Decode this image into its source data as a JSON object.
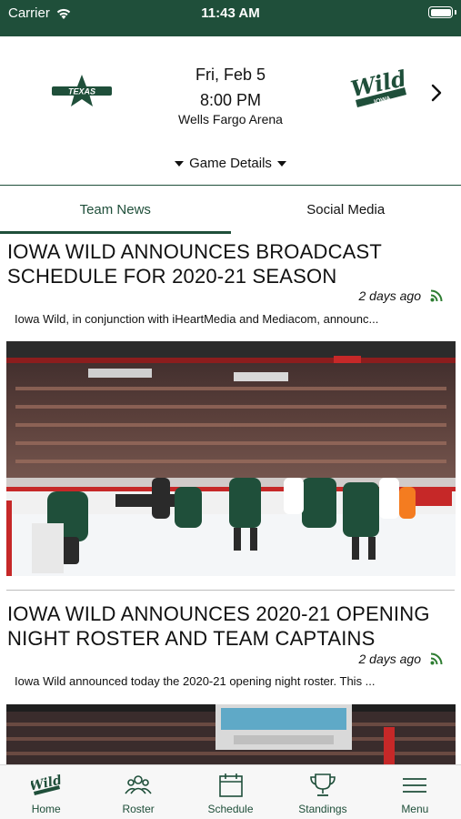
{
  "status_bar": {
    "carrier": "Carrier",
    "time": "11:43 AM",
    "icons": [
      "wifi-icon",
      "battery-icon"
    ]
  },
  "game": {
    "away_team_logo": "texas-stars-logo",
    "home_team_logo": "iowa-wild-logo",
    "home_logo_text": "Wild",
    "home_logo_subtext": "IOWA",
    "away_logo_text": "TEXAS",
    "date": "Fri, Feb 5",
    "time": "8:00 PM",
    "venue": "Wells Fargo Arena",
    "details_label": "Game Details"
  },
  "tabs": [
    {
      "label": "Team News",
      "active": true
    },
    {
      "label": "Social Media",
      "active": false
    }
  ],
  "articles": [
    {
      "headline_line1": "IOWA WILD ANNOUNCES BROADCAST",
      "headline_line2": "SCHEDULE FOR 2020-21 SEASON",
      "age": "2 days ago",
      "excerpt": "Iowa Wild, in conjunction with iHeartMedia and Mediacom, announc...",
      "image": "hockey-faceoff-photo"
    },
    {
      "headline_line1": "IOWA WILD ANNOUNCES 2020-21 OPENING",
      "headline_line2": "NIGHT ROSTER AND TEAM CAPTAINS",
      "age": "2 days ago",
      "excerpt": "Iowa Wild announced today the 2020-21 opening night roster. This ...",
      "image": "arena-scoreboard-photo"
    }
  ],
  "bottom_nav": [
    {
      "label": "Home",
      "icon": "wild-logo-icon"
    },
    {
      "label": "Roster",
      "icon": "roster-icon"
    },
    {
      "label": "Schedule",
      "icon": "calendar-icon"
    },
    {
      "label": "Standings",
      "icon": "trophy-icon"
    },
    {
      "label": "Menu",
      "icon": "hamburger-icon"
    }
  ],
  "colors": {
    "brand_green": "#1f4f3a",
    "rss_green": "#2e7d32",
    "text": "#111111"
  }
}
